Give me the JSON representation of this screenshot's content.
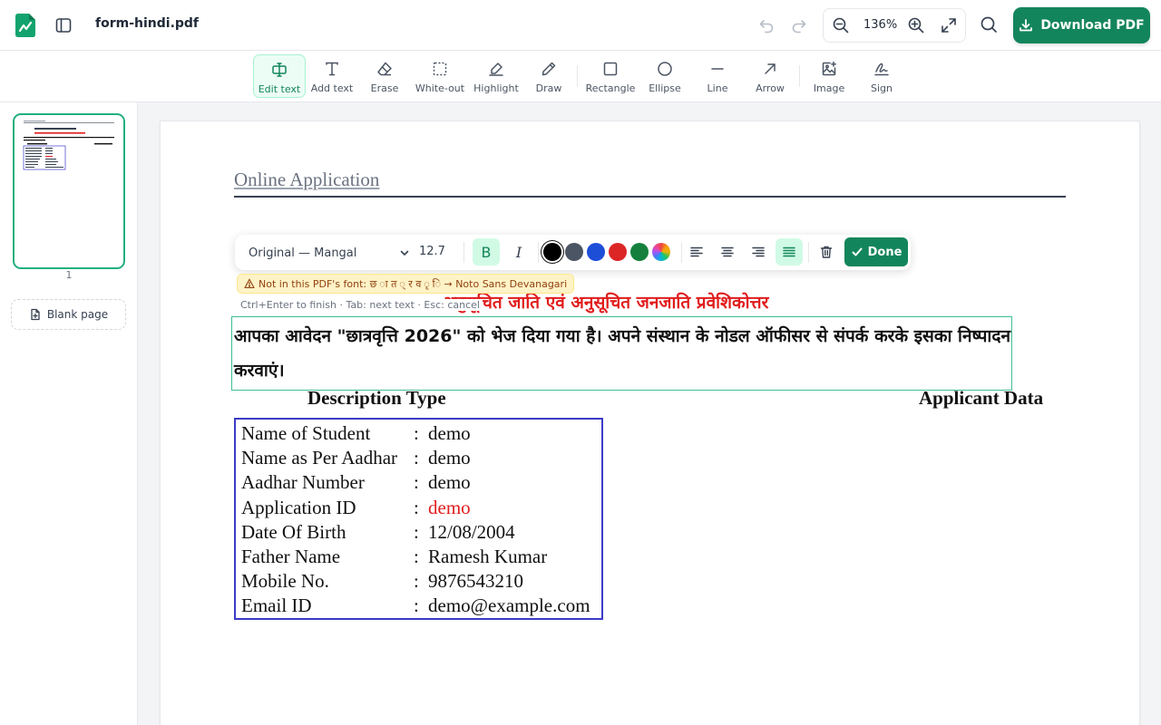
{
  "app": {
    "filename": "form-hindi.pdf",
    "zoom": "136%",
    "download_label": "Download PDF"
  },
  "tools": [
    {
      "label": "Edit text",
      "icon": "edit-text-icon"
    },
    {
      "label": "Add text",
      "icon": "text-icon"
    },
    {
      "label": "Erase",
      "icon": "eraser-icon"
    },
    {
      "label": "White-out",
      "icon": "whiteout-icon"
    },
    {
      "label": "Highlight",
      "icon": "highlighter-icon"
    },
    {
      "label": "Draw",
      "icon": "pencil-icon"
    },
    {
      "label": "Rectangle",
      "icon": "rectangle-icon"
    },
    {
      "label": "Ellipse",
      "icon": "ellipse-icon"
    },
    {
      "label": "Line",
      "icon": "line-icon"
    },
    {
      "label": "Arrow",
      "icon": "arrow-icon"
    },
    {
      "label": "Image",
      "icon": "image-icon"
    },
    {
      "label": "Sign",
      "icon": "signature-icon"
    }
  ],
  "sidebar": {
    "page_number": "1",
    "blank_page_label": "Blank page"
  },
  "format_bar": {
    "font": "Original — Mangal",
    "size": "12.7",
    "bold_label": "B",
    "italic_label": "I",
    "colors": [
      "#000000",
      "#4b5563",
      "#1d4ed8",
      "#dc2626",
      "#15803d"
    ],
    "done_label": "Done",
    "warning": "Not in this PDF's font: छ ा त ् र व ृ ि → Noto Sans Devanagari",
    "hint": "Ctrl+Enter to finish · Tab: next text · Esc: cancel"
  },
  "document": {
    "title": "Online Application",
    "hindi_heading": "अनुसूचित जाति एवं अनुसूचित जनजाति प्रवेशिकोत्तर",
    "editing_text": "आपका आवेदन \"छात्रवृत्ति 2026\" को भेज दिया गया है। अपने संस्थान के नोडल ऑफीसर से संपर्क करके इसका निष्पादन करवाएं।",
    "col_description": "Description Type",
    "col_applicant": "Applicant Data",
    "rows": [
      {
        "label": "Name of Student",
        "colon": ":",
        "value": "demo"
      },
      {
        "label": "Name as Per Aadhar",
        "colon": ":",
        "value": "demo"
      },
      {
        "label": "Aadhar Number",
        "colon": ":",
        "value": "demo"
      },
      {
        "label": "Application ID",
        "colon": ":",
        "value": "demo"
      },
      {
        "label": "Date Of Birth",
        "colon": ":",
        "value": "12/08/2004"
      },
      {
        "label": "Father Name",
        "colon": ":",
        "value": "Ramesh Kumar"
      },
      {
        "label": "Mobile No.",
        "colon": ":",
        "value": "9876543210"
      },
      {
        "label": "Email ID",
        "colon": ":",
        "value": "demo@example.com"
      }
    ]
  }
}
